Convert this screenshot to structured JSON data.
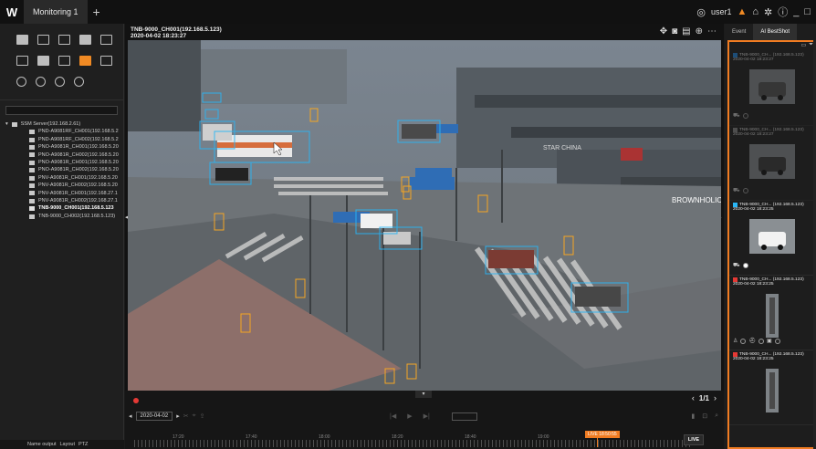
{
  "topbar": {
    "logo": "W",
    "tab_label": "Monitoring 1",
    "add_tab": "+",
    "user": "user1"
  },
  "left": {
    "tree_root": "SSM Server(192.168.2.61)",
    "cameras": [
      {
        "label": "PND-A9081RF_CH001(192.168.5.2",
        "selected": false
      },
      {
        "label": "PND-A9081RF_CH002(192.168.5.2",
        "selected": false
      },
      {
        "label": "PNO-A9081R_CH001(192.168.5.20",
        "selected": false
      },
      {
        "label": "PNO-A9081R_CH002(192.168.5.20",
        "selected": false
      },
      {
        "label": "PNO-A9081R_CH001(192.168.5.20",
        "selected": false
      },
      {
        "label": "PNO-A9081R_CH002(192.168.5.20",
        "selected": false
      },
      {
        "label": "PNV-A9081R_CH001(192.168.5.20",
        "selected": false
      },
      {
        "label": "PNV-A9081R_CH002(192.168.5.20",
        "selected": false
      },
      {
        "label": "PNV-A9081R_CH001(192.168.27.1",
        "selected": false
      },
      {
        "label": "PNV-A9081R_CH002(192.168.27.1",
        "selected": false
      },
      {
        "label": "TNB-9000_CH001(192.168.5.123",
        "selected": true
      },
      {
        "label": "TNB-9000_CH002(192.168.5.123)",
        "selected": false
      }
    ],
    "bottom_tabs": [
      "Name output",
      "Layout",
      "PTZ"
    ]
  },
  "viewer": {
    "camera_name": "TNB-9000_CH001(192.168.5.123)",
    "timestamp": "2020-04-02 18:23:27",
    "page_indicator": "1/1",
    "playback_date": "2020-04-02",
    "timeline_labels": [
      "17:20",
      "17:40",
      "18:00",
      "18:20",
      "18:40",
      "19:00"
    ],
    "live_time": "LIVE 18:50:55",
    "live_button": "LIVE",
    "storefront_signs": [
      "STAR CHINA",
      "BROWNHOLIC"
    ]
  },
  "right": {
    "tabs": [
      "Event",
      "AI BestShot"
    ],
    "active_tab": "AI BestShot",
    "cards": [
      {
        "title": "TNB-9000_CH... (192.168.5.123)",
        "time": "2020-04-02 18:23:27",
        "color": "#1e88e5",
        "kind": "vehicle",
        "dimmed": true,
        "attrs": "dots-b"
      },
      {
        "title": "TNB-9000_CH... (192.168.5.123)",
        "time": "2020-04-02 18:23:27",
        "color": "#888888",
        "kind": "vehicle",
        "dimmed": true,
        "attrs": "dots-db"
      },
      {
        "title": "TNB-9000_CH... (192.168.5.123)",
        "time": "2020-04-02 18:23:25",
        "color": "#29b6f6",
        "kind": "vehicle",
        "dimmed": false,
        "attrs": "dots-w"
      },
      {
        "title": "TNB-9000_CH... (192.168.5.123)",
        "time": "2020-04-02 18:23:25",
        "color": "#e53935",
        "kind": "person",
        "dimmed": false,
        "attrs": "person"
      },
      {
        "title": "TNB-9000_CH... (192.168.5.123)",
        "time": "2020-04-02 18:23:25",
        "color": "#e53935",
        "kind": "person",
        "dimmed": false,
        "attrs": "none"
      }
    ]
  },
  "colors": {
    "accent": "#f07c22",
    "bbox_vehicle": "#29b6f6",
    "bbox_person": "#f5a623"
  }
}
